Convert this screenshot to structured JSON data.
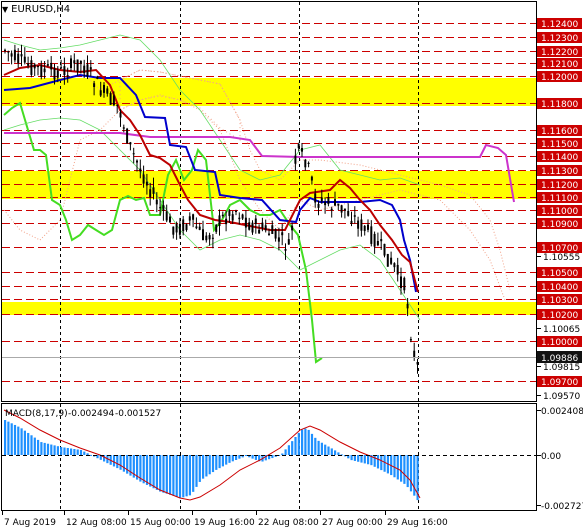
{
  "symbol_title": "EURUSD,H4",
  "macd": {
    "label": "MACD(8,17,9)",
    "values": [
      "-0.002494",
      "-0.001527"
    ],
    "axis_top": "0.002408",
    "axis_zero": "0.00",
    "axis_bottom": "-0.002727"
  },
  "x_labels": [
    "7 Aug 2019",
    "12 Aug 08:00",
    "15 Aug 00:00",
    "19 Aug 16:00",
    "22 Aug 08:00",
    "27 Aug 00:00",
    "29 Aug 16:00"
  ],
  "price_axis": {
    "red_levels": [
      "1.12400",
      "1.12300",
      "1.12200",
      "1.12100",
      "1.12000",
      "1.11800",
      "1.11600",
      "1.11500",
      "1.11400",
      "1.11300",
      "1.11200",
      "1.11100",
      "1.11000",
      "1.10900",
      "1.10700",
      "1.10500",
      "1.10400",
      "1.10300",
      "1.10200",
      "1.10000",
      "1.09700"
    ],
    "plain_levels": [
      "1.10555",
      "1.10065",
      "1.09815",
      "1.09570"
    ],
    "current_price": "1.09886"
  },
  "colors": {
    "red_line": "#cc0000",
    "yellow_band": "#ffff00",
    "magenta": "#cc33cc",
    "green": "#44dd22",
    "blue": "#0000cc",
    "dark_red": "#bb0000",
    "salmon": "#f2a38a",
    "current_bg": "#111111"
  }
}
